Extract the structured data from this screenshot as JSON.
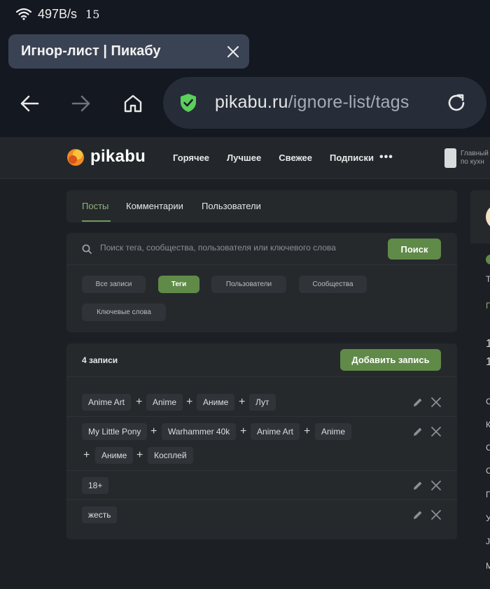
{
  "status": {
    "speed": "497B/s",
    "temp": "15"
  },
  "browser": {
    "tab_title": "Игнор-лист | Пикабу",
    "url_host": "pikabu.ru",
    "url_path": "/ignore-list/tags"
  },
  "site": {
    "logo": "pikabu",
    "nav": [
      "Горячее",
      "Лучшее",
      "Свежее",
      "Подписки"
    ],
    "more": "•••",
    "promo": [
      "Главный",
      "по кухн"
    ]
  },
  "content_tabs": [
    "Посты",
    "Комментарии",
    "Пользователи"
  ],
  "search": {
    "placeholder": "Поиск тега, сообщества, пользователя или ключевого слова",
    "button": "Поиск"
  },
  "filters": [
    "Все записи",
    "Теги",
    "Пользователи",
    "Сообщества",
    "Ключевые слова"
  ],
  "list": {
    "count": "4 записи",
    "add_button": "Добавить запись",
    "rows": [
      {
        "tags": [
          "Anime Art",
          "Anime",
          "Аниме",
          "Лут"
        ]
      },
      {
        "tags": [
          "My Little Pony",
          "Warhammer 40k",
          "Anime Art",
          "Anime",
          "Аниме",
          "Косплей"
        ]
      },
      {
        "tags": [
          "18+"
        ]
      },
      {
        "tags": [
          "жесть"
        ]
      }
    ]
  },
  "right_col": {
    "chars": [
      "Т",
      "П",
      "1",
      "1",
      "С",
      "К",
      "С",
      "С",
      "П",
      "У",
      "Ј",
      "М"
    ]
  },
  "colors": {
    "accent": "#5f8a48",
    "accent_text": "#8fb37a",
    "card": "#26292c",
    "page": "#1c2024"
  }
}
